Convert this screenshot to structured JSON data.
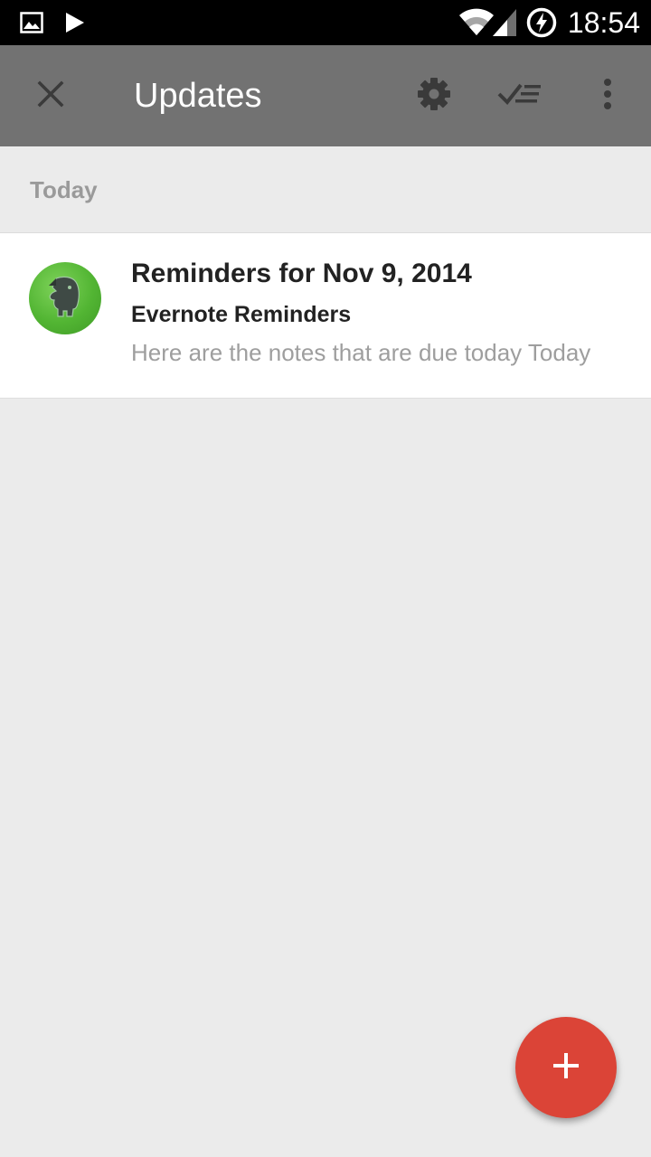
{
  "status_bar": {
    "time": "18:54",
    "icons": [
      "gallery-icon",
      "play-store-icon",
      "wifi-icon",
      "signal-icon",
      "battery-charging-icon"
    ]
  },
  "toolbar": {
    "title": "Updates",
    "icons": [
      "close-icon",
      "settings-icon",
      "mark-all-done-icon",
      "more-vert-icon"
    ]
  },
  "section": {
    "label": "Today"
  },
  "items": [
    {
      "title": "Reminders for Nov 9, 2014",
      "sender": "Evernote Reminders",
      "snippet": "Here are the notes that are due today Today",
      "avatar_icon": "evernote-elephant-icon"
    }
  ],
  "fab": {
    "icon": "plus-icon"
  },
  "colors": {
    "toolbar": "#727272",
    "background": "#ebebeb",
    "fab": "#db4437",
    "avatar": "#52b533"
  }
}
